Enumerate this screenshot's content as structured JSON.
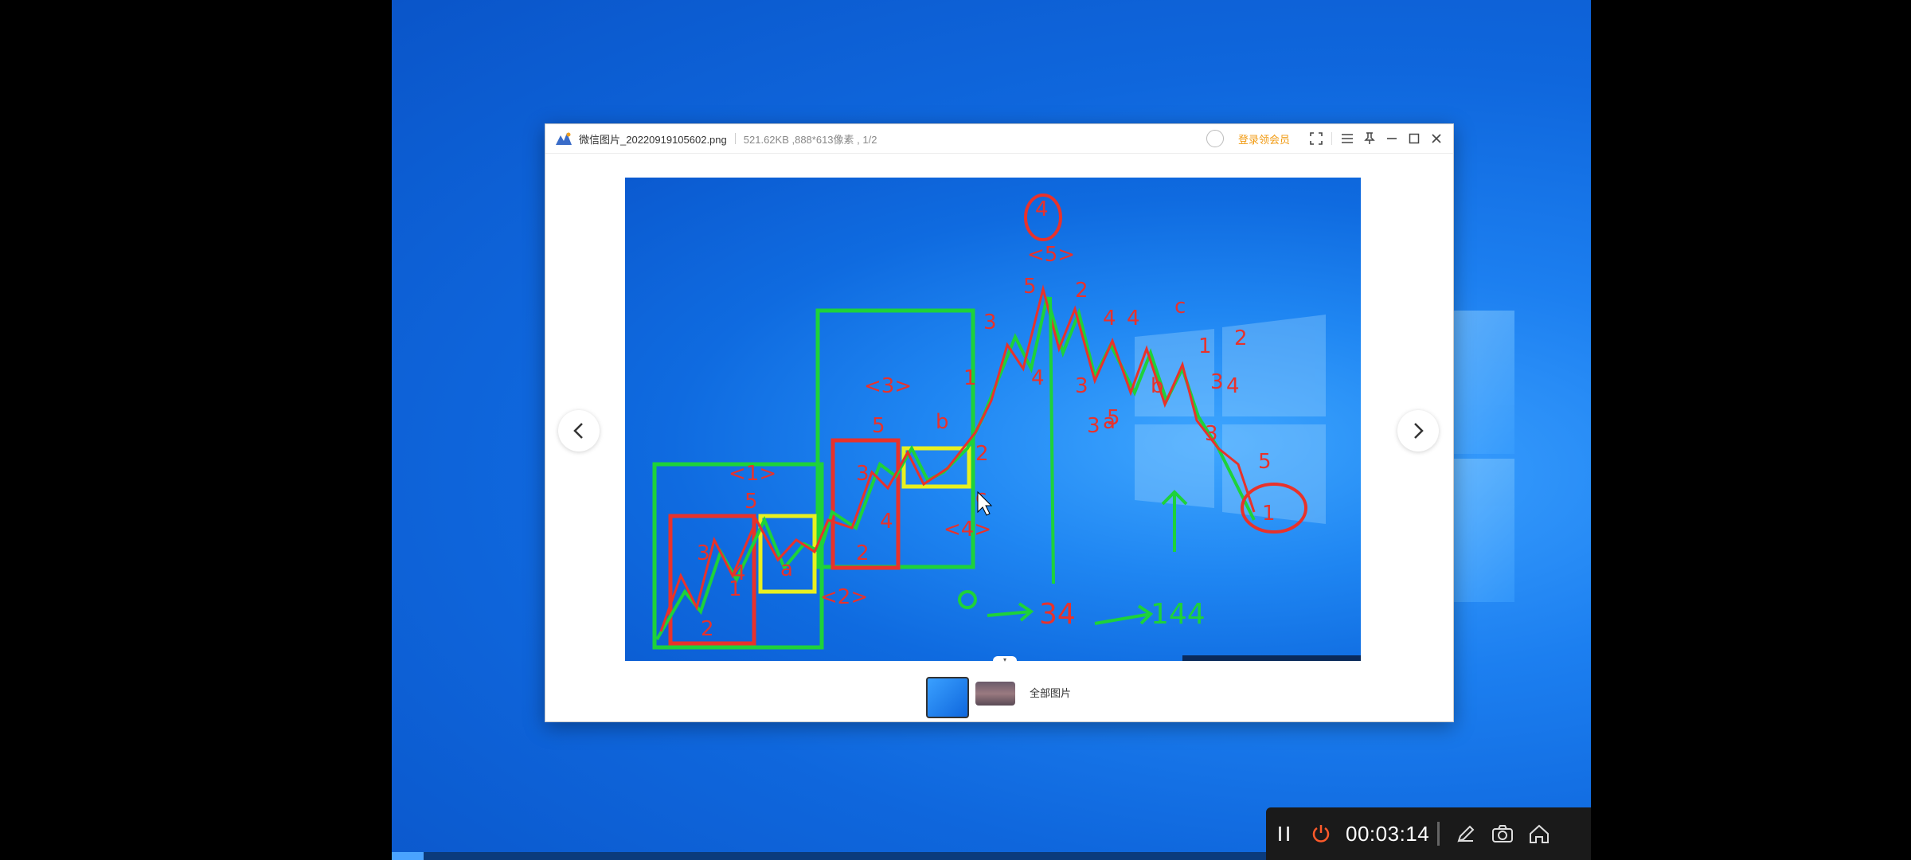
{
  "viewer": {
    "filename": "微信图片_20220919105602.png",
    "meta": "521.62KB ,888*613像素 , 1/2",
    "login_label": "登录领会员",
    "all_photos_label": "全部图片",
    "prev_icon": "chevron-left-icon",
    "next_icon": "chevron-right-icon"
  },
  "annotation": {
    "labels": [
      "<1>",
      "5",
      "3",
      "1",
      "4",
      "2",
      "a",
      "<2>",
      "3",
      "2",
      "4",
      "<3>",
      "5",
      "b",
      "<4>",
      "c",
      "<5>",
      "4",
      "5",
      "3",
      "1",
      "2",
      "2",
      "4",
      "3",
      "4",
      "c",
      "4",
      "a",
      "b",
      "3",
      "1",
      "5",
      "3",
      "1",
      "3",
      "4",
      "5",
      "2",
      "34",
      "144"
    ]
  },
  "recorder": {
    "time": "00:03:14",
    "pause_icon": "pause-icon",
    "stop_icon": "power-icon",
    "pen_icon": "pen-icon",
    "camera_icon": "camera-icon",
    "home_icon": "home-icon"
  },
  "colors": {
    "desktop_blue": "#1c7ff0",
    "accent_orange": "#f19a11",
    "annotation_red": "#e8322b",
    "annotation_green": "#1ed23a",
    "annotation_yellow": "#e8f020"
  }
}
